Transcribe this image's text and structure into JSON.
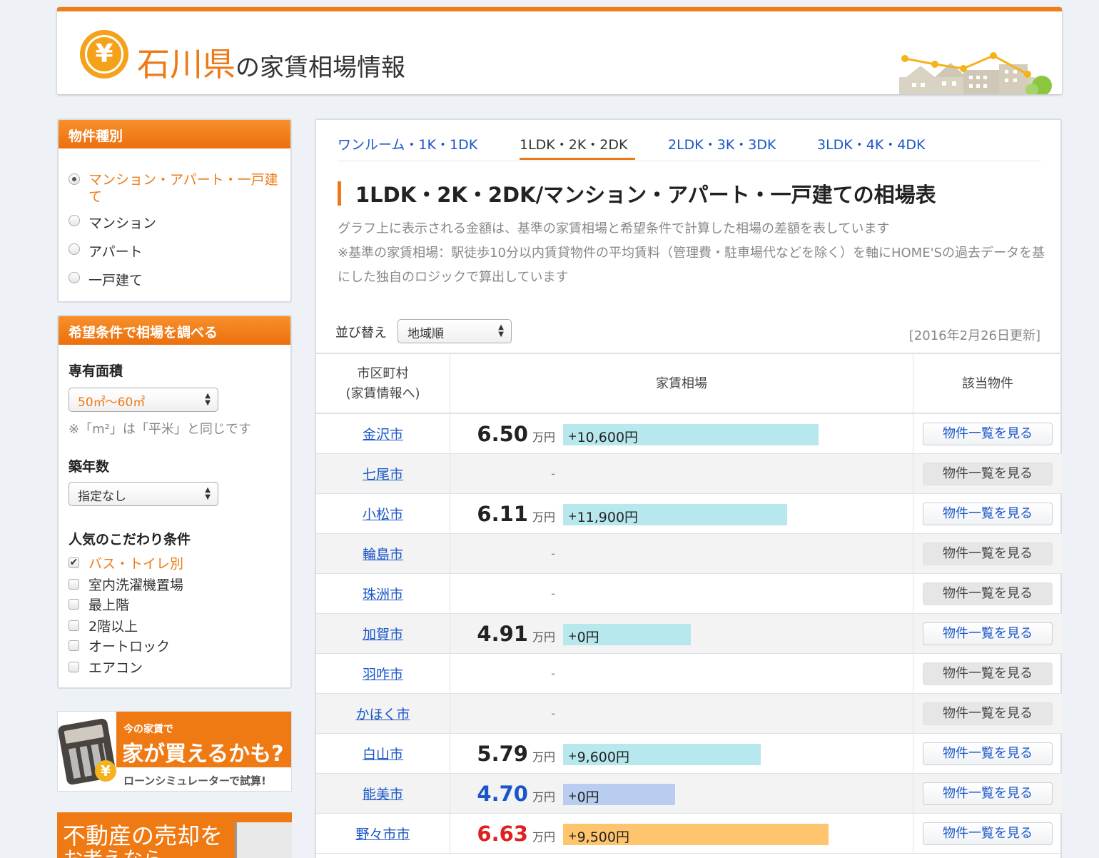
{
  "header": {
    "logo_glyph": "¥",
    "prefecture": "石川県",
    "title_rest": "の家賃相場情報"
  },
  "property_type": {
    "heading": "物件種別",
    "options": [
      {
        "label": "マンション・アパート・一戸建て",
        "checked": true
      },
      {
        "label": "マンション",
        "checked": false
      },
      {
        "label": "アパート",
        "checked": false
      },
      {
        "label": "一戸建て",
        "checked": false
      }
    ]
  },
  "conditions": {
    "heading": "希望条件で相場を調べる",
    "area_label": "専有面積",
    "area_value": "50㎡〜60㎡",
    "area_note": "※「m²」は「平米」と同じです",
    "age_label": "築年数",
    "age_value": "指定なし",
    "popular_label": "人気のこだわり条件",
    "checkboxes": [
      {
        "label": "バス・トイレ別",
        "checked": true
      },
      {
        "label": "室内洗濯機置場",
        "checked": false
      },
      {
        "label": "最上階",
        "checked": false
      },
      {
        "label": "2階以上",
        "checked": false
      },
      {
        "label": "オートロック",
        "checked": false
      },
      {
        "label": "エアコン",
        "checked": false
      }
    ]
  },
  "banner_loan": {
    "small": "今の家賃で",
    "big": "家が買えるかも?",
    "sub": "ローンシミュレーターで試算!"
  },
  "banner_sell": {
    "line1": "不動産の売却を",
    "line2": "お考えなら"
  },
  "tabs": [
    {
      "label": "ワンルーム・1K・1DK",
      "active": false
    },
    {
      "label": "1LDK・2K・2DK",
      "active": true
    },
    {
      "label": "2LDK・3K・3DK",
      "active": false
    },
    {
      "label": "3LDK・4K・4DK",
      "active": false
    }
  ],
  "main": {
    "title": "1LDK・2K・2DK/マンション・アパート・一戸建ての相場表",
    "desc1": "グラフ上に表示される金額は、基準の家賃相場と希望条件で計算した相場の差額を表しています",
    "desc2": "※基準の家賃相場：駅徒歩10分以内賃貸物件の平均賃料（管理費・駐車場代などを除く）を軸にHOME'Sの過去データを基にした独自のロジックで算出しています",
    "sort_label": "並び替え",
    "sort_value": "地域順",
    "updated": "[2016年2月26日更新]"
  },
  "table": {
    "col_city": "市区町村",
    "col_city_sub": "(家賃情報へ)",
    "col_rent": "家賃相場",
    "col_listing": "該当物件",
    "unit": "万円",
    "button_label": "物件一覧を見る",
    "no_data": "-",
    "rows": [
      {
        "city": "金沢市",
        "price": "6.50",
        "price_color": "#222222",
        "diff": "10,600円",
        "bar_fraction": 0.73,
        "bar_color": "#b7e8ee",
        "enabled": true
      },
      {
        "city": "七尾市",
        "price": null,
        "enabled": false
      },
      {
        "city": "小松市",
        "price": "6.11",
        "price_color": "#222222",
        "diff": "11,900円",
        "bar_fraction": 0.64,
        "bar_color": "#b7e8ee",
        "enabled": true
      },
      {
        "city": "輪島市",
        "price": null,
        "enabled": false
      },
      {
        "city": "珠洲市",
        "price": null,
        "enabled": false
      },
      {
        "city": "加賀市",
        "price": "4.91",
        "price_color": "#222222",
        "diff": "0円",
        "bar_fraction": 0.365,
        "bar_color": "#b7e8ee",
        "enabled": true
      },
      {
        "city": "羽咋市",
        "price": null,
        "enabled": false
      },
      {
        "city": "かほく市",
        "price": null,
        "enabled": false
      },
      {
        "city": "白山市",
        "price": "5.79",
        "price_color": "#222222",
        "diff": "9,600円",
        "bar_fraction": 0.565,
        "bar_color": "#b7e8ee",
        "enabled": true
      },
      {
        "city": "能美市",
        "price": "4.70",
        "price_color": "#1a56c8",
        "diff": "0円",
        "bar_fraction": 0.32,
        "bar_color": "#b8cdf0",
        "enabled": true
      },
      {
        "city": "野々市市",
        "price": "6.63",
        "price_color": "#e02020",
        "diff": "9,500円",
        "bar_fraction": 0.76,
        "bar_color": "#ffc56e",
        "enabled": true
      }
    ]
  }
}
